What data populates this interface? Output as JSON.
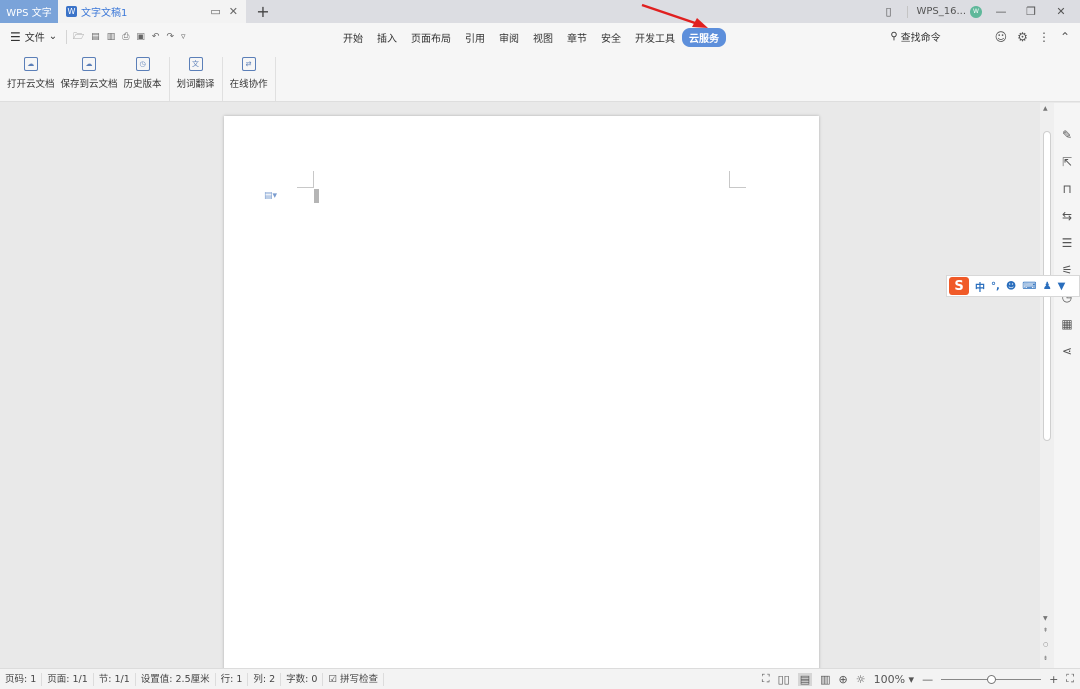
{
  "titlebar": {
    "app_name": "WPS 文字",
    "doc_tab": "文字文稿1",
    "new_tab": "+",
    "account": "WPS_16...",
    "avatar_text": "W"
  },
  "menubar": {
    "file_label": "文件",
    "tabs": [
      "开始",
      "插入",
      "页面布局",
      "引用",
      "审阅",
      "视图",
      "章节",
      "安全",
      "开发工具",
      "云服务"
    ],
    "active_tab": "云服务",
    "search_label": "查找命令"
  },
  "ribbon": {
    "buttons": [
      {
        "label": "打开云文档",
        "icon": "cloud-open-icon"
      },
      {
        "label": "保存到云文档",
        "icon": "cloud-save-icon"
      },
      {
        "label": "历史版本",
        "icon": "history-version-icon"
      },
      {
        "label": "划词翻译",
        "icon": "translate-icon"
      },
      {
        "label": "在线协作",
        "icon": "collaboration-icon"
      }
    ]
  },
  "ime": {
    "mode": "中",
    "punct": "°,"
  },
  "statusbar": {
    "page_no": "页码: 1",
    "page": "页面: 1/1",
    "section": "节: 1/1",
    "setting": "设置值: 2.5厘米",
    "row": "行: 1",
    "col": "列: 2",
    "words": "字数: 0",
    "spell": "拼写检查",
    "zoom": "100%"
  },
  "colors": {
    "active_tab": "#5d8fdb",
    "app_tab": "#7aa3d9",
    "arrow": "#e02020",
    "ime_logo": "#f05a28"
  }
}
